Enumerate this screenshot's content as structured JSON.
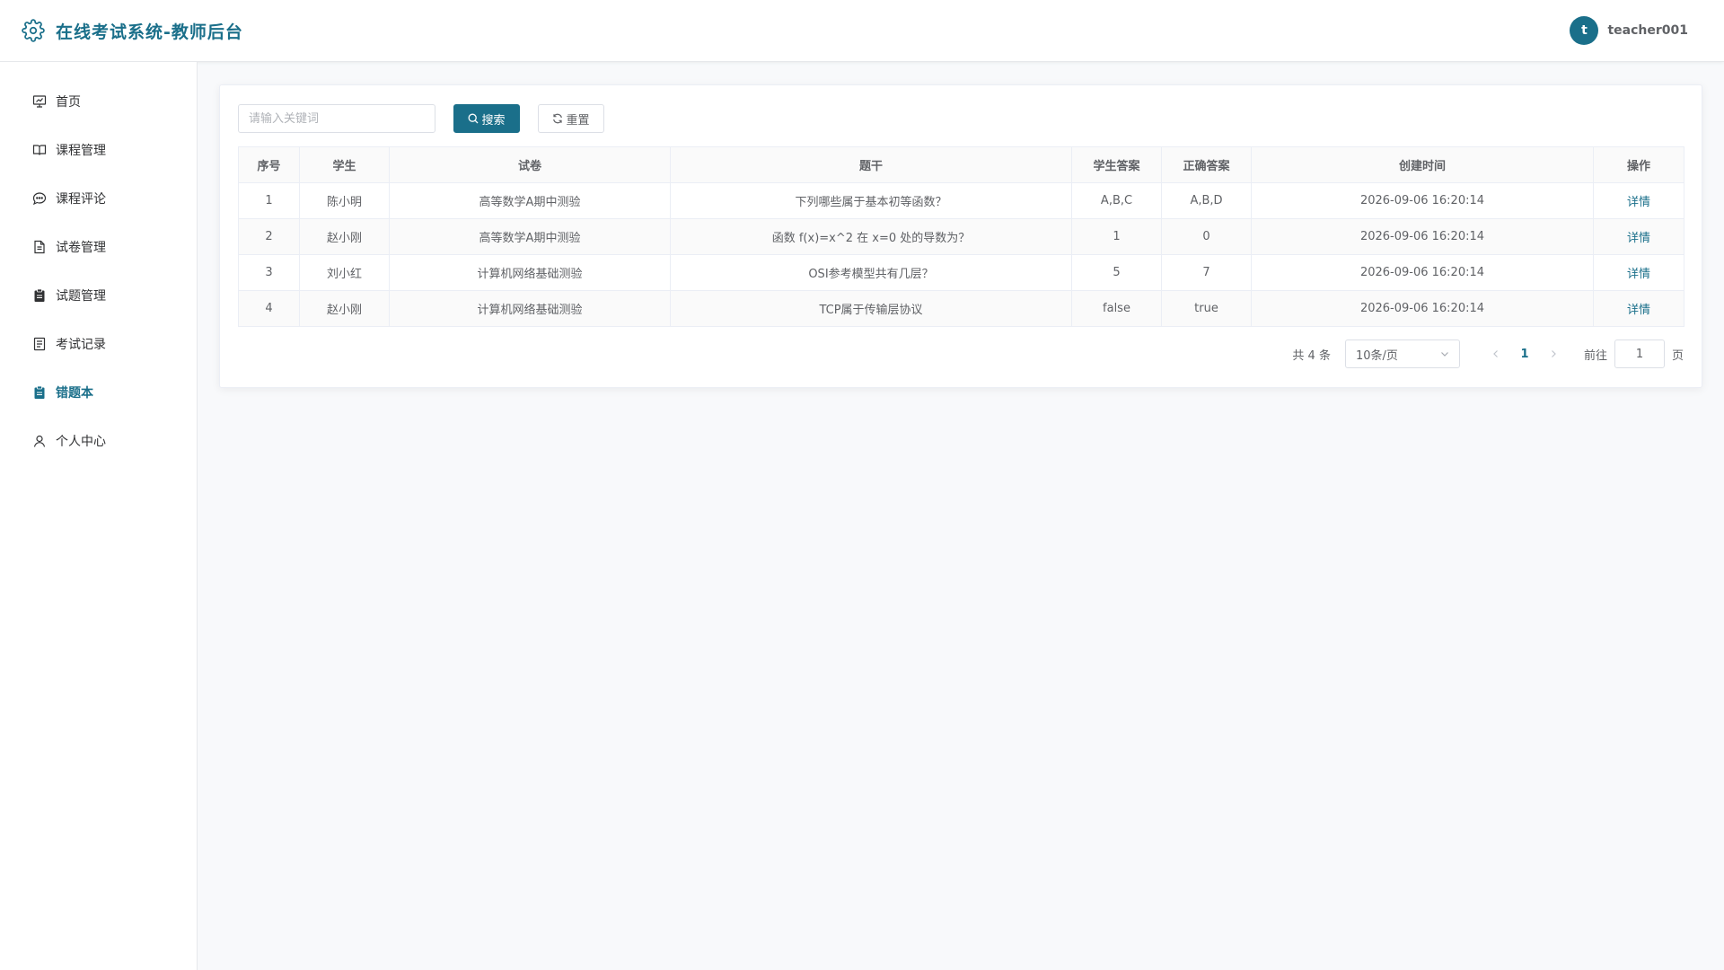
{
  "header": {
    "title": "在线考试系统-教师后台",
    "avatar_letter": "t",
    "username": "teacher001"
  },
  "colors": {
    "accent": "#1a6f8a",
    "text": "#606266",
    "border": "#ebeef5",
    "background": "#f8f9fb"
  },
  "sidebar": {
    "items": [
      {
        "label": "首页",
        "icon": "presentation-icon"
      },
      {
        "label": "课程管理",
        "icon": "book-icon"
      },
      {
        "label": "课程评论",
        "icon": "chat-icon"
      },
      {
        "label": "试卷管理",
        "icon": "document-icon"
      },
      {
        "label": "试题管理",
        "icon": "clipboard-icon"
      },
      {
        "label": "考试记录",
        "icon": "record-icon"
      },
      {
        "label": "错题本",
        "icon": "notebook-icon",
        "active": true
      },
      {
        "label": "个人中心",
        "icon": "user-icon"
      }
    ]
  },
  "search": {
    "placeholder": "请输入关键词",
    "value": ""
  },
  "toolbar": {
    "search_label": "搜索",
    "reset_label": "重置"
  },
  "table": {
    "columns": [
      "序号",
      "学生",
      "试卷",
      "题干",
      "学生答案",
      "正确答案",
      "创建时间",
      "操作"
    ],
    "rows": [
      {
        "index": "1",
        "student": "陈小明",
        "paper": "高等数学A期中测验",
        "question": "下列哪些属于基本初等函数？",
        "student_answer": "A,B,C",
        "correct_answer": "A,B,D",
        "created": "2026-09-06 16:20:14",
        "action": "详情"
      },
      {
        "index": "2",
        "student": "赵小刚",
        "paper": "高等数学A期中测验",
        "question": "函数 f(x)=x^2 在 x=0 处的导数为？",
        "student_answer": "1",
        "correct_answer": "0",
        "created": "2026-09-06 16:20:14",
        "action": "详情"
      },
      {
        "index": "3",
        "student": "刘小红",
        "paper": "计算机网络基础测验",
        "question": "OSI参考模型共有几层？",
        "student_answer": "5",
        "correct_answer": "7",
        "created": "2026-09-06 16:20:14",
        "action": "详情"
      },
      {
        "index": "4",
        "student": "赵小刚",
        "paper": "计算机网络基础测验",
        "question": "TCP属于传输层协议",
        "student_answer": "false",
        "correct_answer": "true",
        "created": "2026-09-06 16:20:14",
        "action": "详情"
      }
    ]
  },
  "pagination": {
    "total": "共 4 条",
    "page_size": "10条/页",
    "current_page": "1",
    "goto_label": "前往",
    "goto_value": "1",
    "page_suffix": "页"
  }
}
